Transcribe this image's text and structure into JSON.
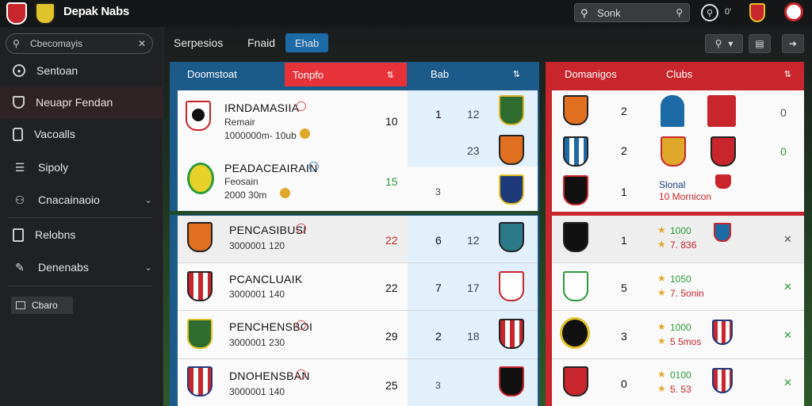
{
  "app": {
    "brand": "Depak Nabs"
  },
  "top": {
    "search_text": "Sonk",
    "status_text": "0'"
  },
  "sidebar": {
    "search_placeholder": "Cbecomayis",
    "items": [
      {
        "label": "Sentoan",
        "icon": "compass-icon"
      },
      {
        "label": "Neuapr Fendan",
        "icon": "shield-icon"
      },
      {
        "label": "Vacoalls",
        "icon": "phone-icon"
      },
      {
        "label": "Sipoly",
        "icon": "list-icon"
      },
      {
        "label": "Cnacainaoio",
        "icon": "people-icon"
      },
      {
        "label": "Relobns",
        "icon": "book-icon"
      },
      {
        "label": "Denenabs",
        "icon": "pen-icon"
      }
    ],
    "footer_btn": "Cbaro"
  },
  "tabs": [
    "Serpesios",
    "Fnaid",
    "Ehab"
  ],
  "left_panel": {
    "headers": [
      "Doomstoat",
      "Tonpfo",
      "Bab"
    ],
    "rows": [
      {
        "name": "IRNDAMASIIA",
        "line2": "Remair",
        "line3": "1000000m- 10ub",
        "score": "10",
        "pos": "1",
        "pts": "12"
      },
      {
        "name": "",
        "line2": "",
        "line3": "",
        "score": "",
        "pos": "",
        "pts": "23"
      },
      {
        "name": "PEADACEAIRAIN",
        "line2": "Feosain",
        "line3": "2000 30m",
        "score": "15",
        "pos": "3",
        "pts": ""
      },
      {
        "name": "PENCASIBUSI",
        "line2": "",
        "line3": "3000001 120",
        "score": "22",
        "pos": "6",
        "pts": "12"
      },
      {
        "name": "PCANCLUAIK",
        "line2": "",
        "line3": "3000001 140",
        "score": "22",
        "pos": "7",
        "pts": "17"
      },
      {
        "name": "PENCHENSBOI",
        "line2": "",
        "line3": "3000001 230",
        "score": "29",
        "pos": "2",
        "pts": "18"
      },
      {
        "name": "DNOHENSBAN",
        "line2": "",
        "line3": "3000001 140",
        "score": "25",
        "pos": "3",
        "pts": ""
      }
    ]
  },
  "right_panel": {
    "headers": [
      "Domanigos",
      "Clubs"
    ],
    "rows": [
      {
        "value": "2",
        "result": "0",
        "line1": "",
        "line2": ""
      },
      {
        "value": "2",
        "result": "0",
        "line1": "",
        "line2": ""
      },
      {
        "value": "1",
        "result": "",
        "line1": "Slonal",
        "line2": "10 Mornicon"
      },
      {
        "value": "1",
        "result": "✕",
        "line1": "1000",
        "line2": "7. 836"
      },
      {
        "value": "5",
        "result": "✕",
        "line1": "1050",
        "line2": "7. 5onin"
      },
      {
        "value": "3",
        "result": "✕",
        "line1": "1000",
        "line2": "5 5mos"
      },
      {
        "value": "0",
        "result": "✕",
        "line1": "0100",
        "line2": "5. 53"
      }
    ]
  },
  "colors": {
    "accent_red": "#e8323a",
    "accent_blue": "#1c6aa6",
    "green": "#2f9a3a"
  }
}
